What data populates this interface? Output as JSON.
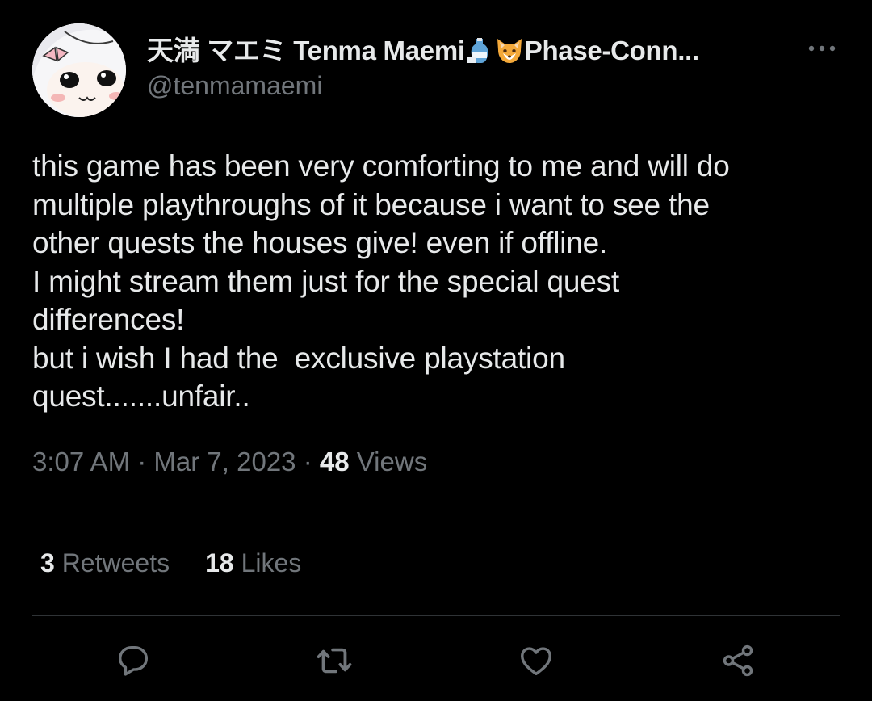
{
  "author": {
    "name_part1": "天満 マエミ Tenma Maemi",
    "name_part2": "Phase-Conn...",
    "handle": "@tenmamaemi",
    "emoji_icons": [
      "sake-icon",
      "fox-icon"
    ]
  },
  "tweet": {
    "text": "this game has been very comforting to me and will do\nmultiple playthroughs of it because i want to see the\nother quests the houses give! even if offline.\nI might stream them just for the special quest\ndifferences!\nbut i wish I had the  exclusive playstation\nquest.......unfair.."
  },
  "meta": {
    "time": "3:07 AM",
    "separator": "·",
    "date": "Mar 7, 2023",
    "views_count": "48",
    "views_label": "Views"
  },
  "stats": {
    "retweets_count": "3",
    "retweets_label": "Retweets",
    "likes_count": "18",
    "likes_label": "Likes"
  },
  "actions": [
    "reply-icon",
    "retweet-icon",
    "like-icon",
    "share-icon"
  ],
  "colors": {
    "background": "#000000",
    "text_primary": "#e7e9ea",
    "text_secondary": "#71767b",
    "divider": "#2f3336"
  }
}
